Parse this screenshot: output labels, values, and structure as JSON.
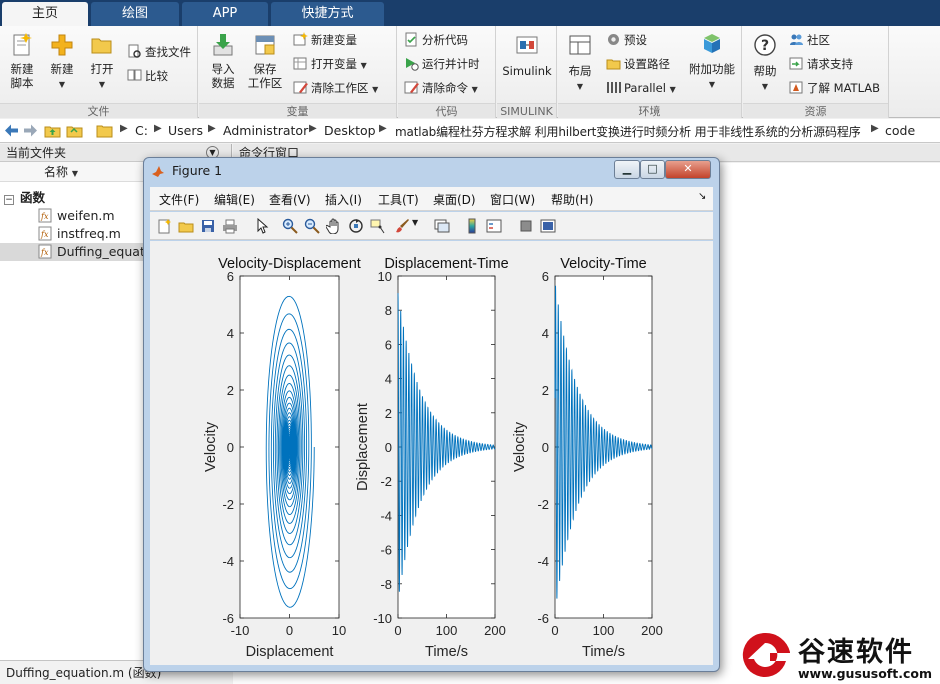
{
  "tabs": [
    {
      "label": "主页",
      "active": true
    },
    {
      "label": "绘图",
      "active": false
    },
    {
      "label": "APP",
      "active": false
    },
    {
      "label": "快捷方式",
      "active": false
    }
  ],
  "ribbon": {
    "file": {
      "group_label": "文件",
      "new_script": "新建\n脚本",
      "new": "新建",
      "open": "打开",
      "find_files": "查找文件",
      "compare": "比较"
    },
    "variable": {
      "group_label": "变量",
      "import_data": "导入\n数据",
      "save_workspace": "保存\n工作区",
      "new_variable": "新建变量",
      "open_variable": "打开变量",
      "clear_workspace": "清除工作区"
    },
    "code": {
      "group_label": "代码",
      "analyze_code": "分析代码",
      "run_and_time": "运行并计时",
      "clear_commands": "清除命令"
    },
    "simulink": {
      "group_label": "SIMULINK",
      "simulink": "Simulink"
    },
    "environment": {
      "group_label": "环境",
      "layout": "布局",
      "preferences": "预设",
      "set_path": "设置路径",
      "parallel": "Parallel",
      "addons": "附加功能"
    },
    "resources": {
      "group_label": "资源",
      "help": "帮助",
      "community": "社区",
      "request_support": "请求支持",
      "learn_matlab": "了解 MATLAB"
    }
  },
  "address": {
    "crumbs": [
      "C:",
      "Users",
      "Administrator",
      "Desktop",
      "matlab编程杜芬方程求解 利用hilbert变换进行时频分析 用于非线性系统的分析源码程序",
      "code"
    ]
  },
  "left_panel": {
    "title": "当前文件夹",
    "column_name": "名称",
    "group_label": "函数",
    "files": [
      "weifen.m",
      "instfreq.m",
      "Duffing_equation.m"
    ],
    "status_text": "Duffing_equation.m  (函数)"
  },
  "command_window": {
    "title": "命令行窗口"
  },
  "figure": {
    "title": "Figure 1",
    "menu": [
      "文件(F)",
      "编辑(E)",
      "查看(V)",
      "插入(I)",
      "工具(T)",
      "桌面(D)",
      "窗口(W)",
      "帮助(H)"
    ],
    "line_color": "#0072bd"
  },
  "chart_data": [
    {
      "type": "line",
      "title": "Velocity-Displacement",
      "xlabel": "Displacement",
      "ylabel": "Velocity",
      "xlim": [
        -10,
        10
      ],
      "ylim": [
        -6,
        6
      ],
      "xticks": [
        -10,
        0,
        10
      ],
      "yticks": [
        -6,
        -4,
        -2,
        0,
        2,
        4,
        6
      ],
      "series": [
        {
          "x_amplitude": 5.0,
          "y_amplitude": 5.8,
          "decay": 0.022,
          "omega": 1.12,
          "t_end": 200
        }
      ]
    },
    {
      "type": "line",
      "title": "Displacement-Time",
      "xlabel": "Time/s",
      "ylabel": "Displacement",
      "xlim": [
        0,
        200
      ],
      "ylim": [
        -10,
        10
      ],
      "xticks": [
        0,
        100,
        200
      ],
      "yticks": [
        -10,
        -8,
        -6,
        -4,
        -2,
        0,
        2,
        4,
        6,
        8,
        10
      ],
      "series": [
        {
          "amplitude": 9.0,
          "decay": 0.022,
          "omega": 1.12
        }
      ]
    },
    {
      "type": "line",
      "title": "Velocity-Time",
      "xlabel": "Time/s",
      "ylabel": "Velocity",
      "xlim": [
        0,
        200
      ],
      "ylim": [
        -6,
        6
      ],
      "xticks": [
        0,
        100,
        200
      ],
      "yticks": [
        -6,
        -4,
        -2,
        0,
        2,
        4,
        6
      ],
      "series": [
        {
          "amplitude": 5.8,
          "decay": 0.022,
          "omega": 1.12
        }
      ]
    }
  ],
  "watermark": {
    "brand": "谷速软件",
    "url": "www.gususoft.com"
  }
}
